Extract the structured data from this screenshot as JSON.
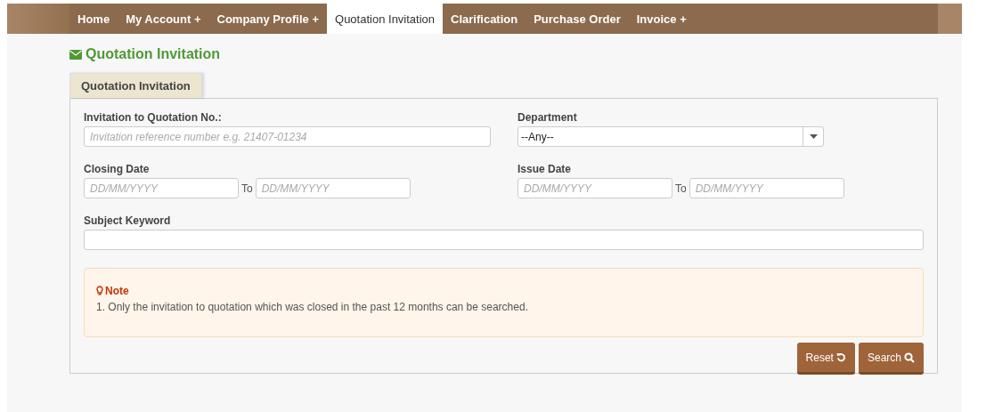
{
  "nav": [
    {
      "label": "Home",
      "selected": false
    },
    {
      "label": "My Account +",
      "selected": false
    },
    {
      "label": "Company Profile +",
      "selected": false
    },
    {
      "label": "Quotation Invitation",
      "selected": true
    },
    {
      "label": "Clarification",
      "selected": false
    },
    {
      "label": "Purchase Order",
      "selected": false
    },
    {
      "label": "Invoice +",
      "selected": false
    }
  ],
  "page_title": "Quotation Invitation",
  "tabs": [
    {
      "label": "Quotation Invitation",
      "selected": true
    }
  ],
  "form": {
    "quotation_no": {
      "label": "Invitation to Quotation No.:",
      "placeholder": "Invitation reference number e.g. 21407-01234"
    },
    "department": {
      "label": "Department",
      "value": "--Any--"
    },
    "closing_date": {
      "label": "Closing Date",
      "from_placeholder": "DD/MM/YYYY",
      "to_label": "To",
      "to_placeholder": "DD/MM/YYYY"
    },
    "issue_date": {
      "label": "Issue Date",
      "from_placeholder": "DD/MM/YYYY",
      "to_label": "To",
      "to_placeholder": "DD/MM/YYYY"
    },
    "subject_keyword": {
      "label": "Subject Keyword"
    }
  },
  "note": {
    "title": "Note",
    "items": [
      {
        "number": "1.",
        "text": "Only the invitation to quotation which was closed in the past 12 months can be searched."
      }
    ]
  },
  "buttons": [
    {
      "label": "Reset",
      "kind": "reset"
    },
    {
      "label": "Search",
      "kind": "search"
    }
  ]
}
